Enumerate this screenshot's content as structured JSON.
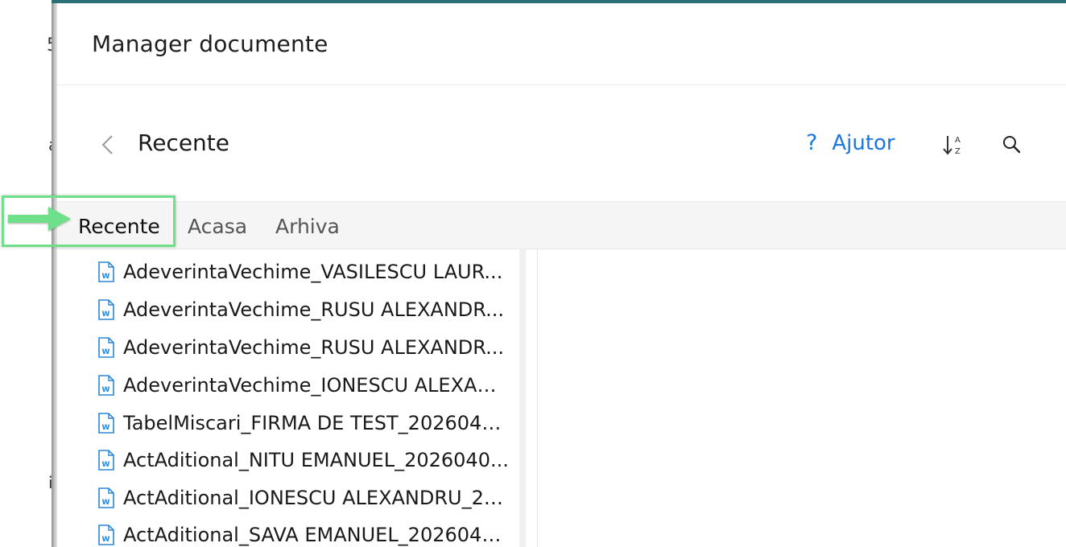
{
  "background": {
    "fragments": [
      "5",
      "a",
      "i"
    ]
  },
  "dialog": {
    "title": "Manager documente"
  },
  "nav": {
    "back_icon": "chevron-left-icon",
    "title": "Recente",
    "help_icon": "?",
    "help_label": "Ajutor",
    "sort_icon": "sort-alpha-icon",
    "search_icon": "search-icon",
    "accent_color": "#1b78e0"
  },
  "tabs": [
    {
      "label": "Recente",
      "active": true
    },
    {
      "label": "Acasa",
      "active": false
    },
    {
      "label": "Arhiva",
      "active": false
    }
  ],
  "files": [
    {
      "name": "AdeverintaVechime_VASILESCU LAUR...",
      "icon": "word-document-icon"
    },
    {
      "name": "AdeverintaVechime_RUSU ALEXANDR...",
      "icon": "word-document-icon"
    },
    {
      "name": "AdeverintaVechime_RUSU ALEXANDR...",
      "icon": "word-document-icon"
    },
    {
      "name": "AdeverintaVechime_IONESCU ALEXAN...",
      "icon": "word-document-icon"
    },
    {
      "name": "TabelMiscari_FIRMA DE TEST_2026040...",
      "icon": "word-document-icon"
    },
    {
      "name": "ActAditional_NITU EMANUEL_2026040...",
      "icon": "word-document-icon"
    },
    {
      "name": "ActAditional_IONESCU ALEXANDRU_20...",
      "icon": "word-document-icon"
    },
    {
      "name": "ActAditional_SAVA EMANUEL_2026040...",
      "icon": "word-document-icon"
    }
  ],
  "annotation": {
    "color": "#6ee08a",
    "target": "Recente"
  }
}
